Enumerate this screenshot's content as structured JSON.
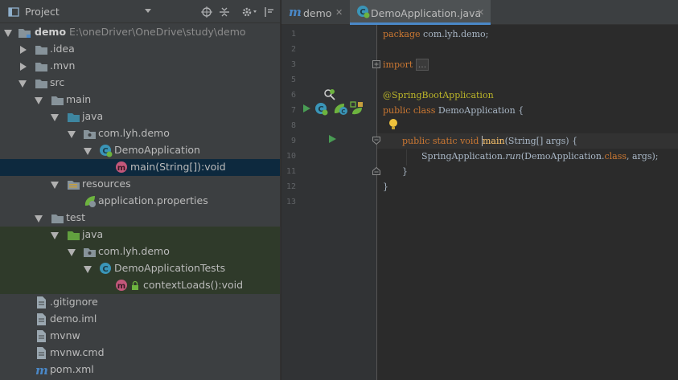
{
  "colors": {
    "panel_bg": "#3c3f41",
    "editor_bg": "#2b2b2b",
    "gutter_bg": "#313335",
    "selection": "#0d293e",
    "test_bg": "#2f3a2a",
    "keyword": "#cc7832",
    "annotation": "#bbb529",
    "method": "#ffc66d",
    "text": "#a9b7c6",
    "tab_accent": "#4a88c7"
  },
  "project_panel": {
    "title": "Project",
    "toolbar_icons": [
      "crosshair-icon",
      "collapse-all-icon",
      "gear-icon",
      "hide-panel-icon"
    ]
  },
  "tree": [
    {
      "label": "demo",
      "path": "E:\\oneDriver\\OneDrive\\study\\demo",
      "icon": "module-folder-icon",
      "expanded": true
    },
    {
      "label": ".idea",
      "icon": "folder-icon",
      "expanded": false
    },
    {
      "label": ".mvn",
      "icon": "folder-icon",
      "expanded": false
    },
    {
      "label": "src",
      "icon": "folder-icon",
      "expanded": true
    },
    {
      "label": "main",
      "icon": "folder-icon",
      "expanded": true
    },
    {
      "label": "java",
      "icon": "source-folder-icon",
      "expanded": true
    },
    {
      "label": "com.lyh.demo",
      "icon": "package-icon",
      "expanded": true
    },
    {
      "label": "DemoApplication",
      "icon": "spring-class-icon",
      "expanded": true
    },
    {
      "label": "main(String[]):void",
      "icon": "method-icon",
      "selected": true
    },
    {
      "label": "resources",
      "icon": "resources-folder-icon",
      "expanded": true
    },
    {
      "label": "application.properties",
      "icon": "spring-properties-icon"
    },
    {
      "label": "test",
      "icon": "folder-icon",
      "expanded": true
    },
    {
      "label": "java",
      "icon": "test-source-folder-icon",
      "expanded": true
    },
    {
      "label": "com.lyh.demo",
      "icon": "package-icon",
      "expanded": true
    },
    {
      "label": "DemoApplicationTests",
      "icon": "test-class-icon",
      "expanded": true
    },
    {
      "label": "contextLoads():void",
      "icon": "method-icon"
    },
    {
      "label": ".gitignore",
      "icon": "text-file-icon"
    },
    {
      "label": "demo.iml",
      "icon": "text-file-icon"
    },
    {
      "label": "mvnw",
      "icon": "text-file-icon"
    },
    {
      "label": "mvnw.cmd",
      "icon": "text-file-icon"
    },
    {
      "label": "pom.xml",
      "icon": "maven-icon"
    }
  ],
  "tabs": [
    {
      "label": "demo",
      "icon": "maven-icon",
      "active": false
    },
    {
      "label": "DemoApplication.java",
      "icon": "spring-class-icon",
      "active": true
    }
  ],
  "editor": {
    "line_numbers": [
      "1",
      "2",
      "3",
      "5",
      "6",
      "7",
      "8",
      "9",
      "10",
      "11",
      "12",
      "13"
    ],
    "code": {
      "l1_kw": "package",
      "l1_rest": " com.lyh.demo;",
      "l3_kw": "import",
      "l3_fold": "...",
      "l6_ann": "@SpringBootApplication",
      "l7_kw": "public class",
      "l7_rest": " DemoApplication {",
      "l9_kw": "public static void",
      "l9_fn": "main",
      "l9_rest": "(String[] args) {",
      "l10_a": "SpringApplication.",
      "l10_b": "run",
      "l10_c": "(DemoApplication.",
      "l10_kw": "class",
      "l10_d": ", args);",
      "l11": "}",
      "l12": "}"
    }
  }
}
